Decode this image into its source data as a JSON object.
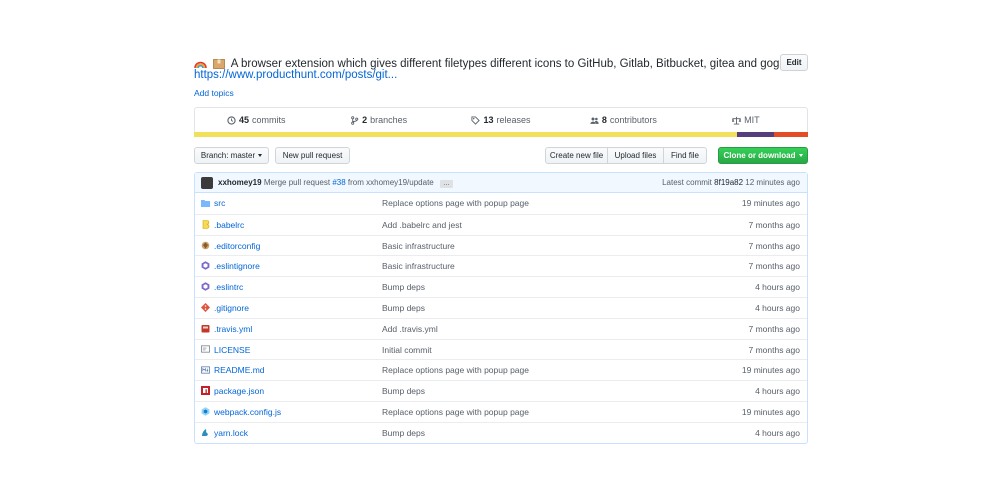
{
  "repo": {
    "description": "A browser extension which gives different filetypes different icons to GitHub, Gitlab, Bitbucket, gitea and gogs.",
    "emojis": [
      "rainbow-icon",
      "package-icon"
    ],
    "homepage": "https://www.producthunt.com/posts/git...",
    "add_topics": "Add topics",
    "edit_label": "Edit"
  },
  "summary": {
    "commits": {
      "count": "45",
      "label": "commits"
    },
    "branches": {
      "count": "2",
      "label": "branches"
    },
    "releases": {
      "count": "13",
      "label": "releases"
    },
    "contributors": {
      "count": "8",
      "label": "contributors"
    },
    "license": "MIT"
  },
  "languages": [
    {
      "color": "#f1e05a",
      "share": 0.885
    },
    {
      "color": "#563d7c",
      "share": 0.06
    },
    {
      "color": "#e34c26",
      "share": 0.055
    }
  ],
  "toolbar": {
    "branch_label": "Branch: master",
    "new_pr": "New pull request",
    "create_file": "Create new file",
    "upload_files": "Upload files",
    "find_file": "Find file",
    "clone": "Clone or download"
  },
  "latest_commit": {
    "author": "xxhomey19",
    "message_prefix": "Merge pull request",
    "pr_number": "#38",
    "message_suffix": "from xxhomey19/update",
    "ellipsis": "…",
    "label": "Latest commit",
    "sha": "8f19a82",
    "age": "12 minutes ago"
  },
  "files": [
    {
      "name": "src",
      "icon": "folder-icon",
      "message": "Replace options page with popup page",
      "age": "19 minutes ago"
    },
    {
      "name": ".babelrc",
      "icon": "babel-icon",
      "message": "Add .babelrc and jest",
      "age": "7 months ago"
    },
    {
      "name": ".editorconfig",
      "icon": "editorconfig-icon",
      "message": "Basic infrastructure",
      "age": "7 months ago"
    },
    {
      "name": ".eslintignore",
      "icon": "eslint-icon",
      "message": "Basic infrastructure",
      "age": "7 months ago"
    },
    {
      "name": ".eslintrc",
      "icon": "eslint-icon",
      "message": "Bump deps",
      "age": "4 hours ago"
    },
    {
      "name": ".gitignore",
      "icon": "git-icon",
      "message": "Bump deps",
      "age": "4 hours ago"
    },
    {
      "name": ".travis.yml",
      "icon": "travis-icon",
      "message": "Add .travis.yml",
      "age": "7 months ago"
    },
    {
      "name": "LICENSE",
      "icon": "license-icon",
      "message": "Initial commit",
      "age": "7 months ago"
    },
    {
      "name": "README.md",
      "icon": "readme-icon",
      "message": "Replace options page with popup page",
      "age": "19 minutes ago"
    },
    {
      "name": "package.json",
      "icon": "npm-icon",
      "message": "Bump deps",
      "age": "4 hours ago"
    },
    {
      "name": "webpack.config.js",
      "icon": "webpack-icon",
      "message": "Replace options page with popup page",
      "age": "19 minutes ago"
    },
    {
      "name": "yarn.lock",
      "icon": "yarn-icon",
      "message": "Bump deps",
      "age": "4 hours ago"
    }
  ]
}
